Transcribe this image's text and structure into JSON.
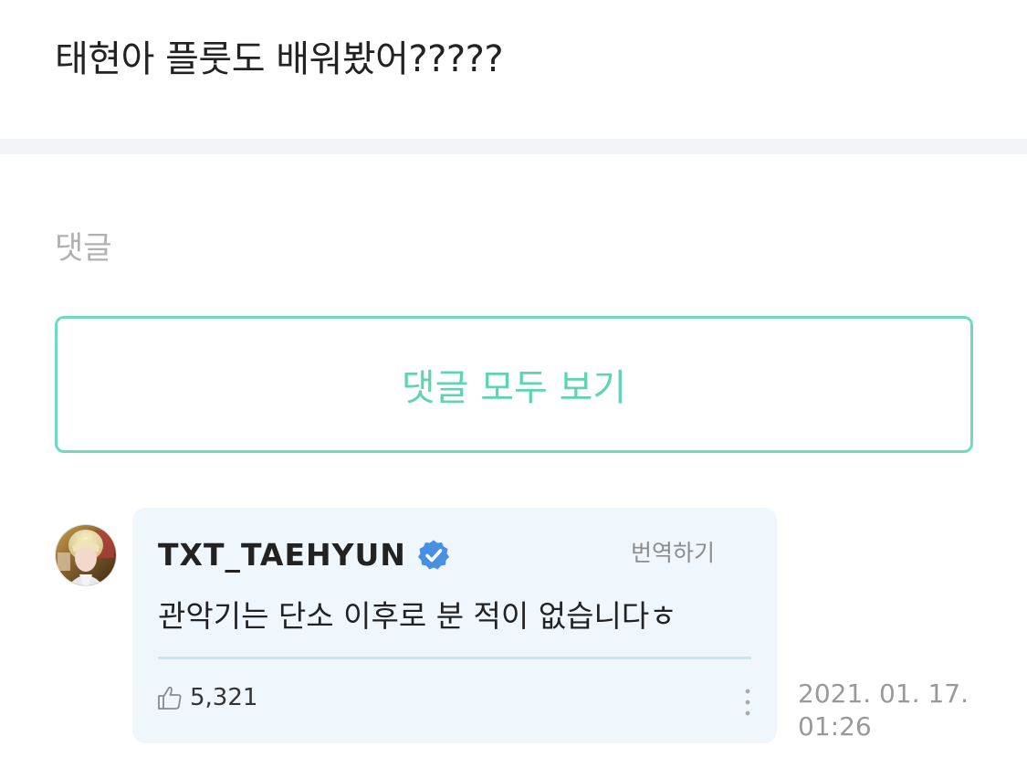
{
  "post": {
    "title": "태현아 플룻도 배워봤어?????"
  },
  "comments_section": {
    "label": "댓글",
    "view_all_label": "댓글 모두 보기"
  },
  "comment": {
    "author": "TXT_TAEHYUN",
    "verified_icon": "verified-badge-icon",
    "translate_label": "번역하기",
    "text": "관악기는 단소 이후로 분 적이 없습니다ㅎ",
    "like_icon": "thumbs-up-icon",
    "likes": "5,321",
    "more_icon": "more-vertical-icon",
    "date": "2021. 01. 17.",
    "time": "01:26"
  },
  "colors": {
    "accent": "#5fd4b4",
    "button_border": "#6ddcbe",
    "bubble_bg": "#eff7fd",
    "verified": "#4a90e2",
    "muted": "#b0b0b0"
  }
}
